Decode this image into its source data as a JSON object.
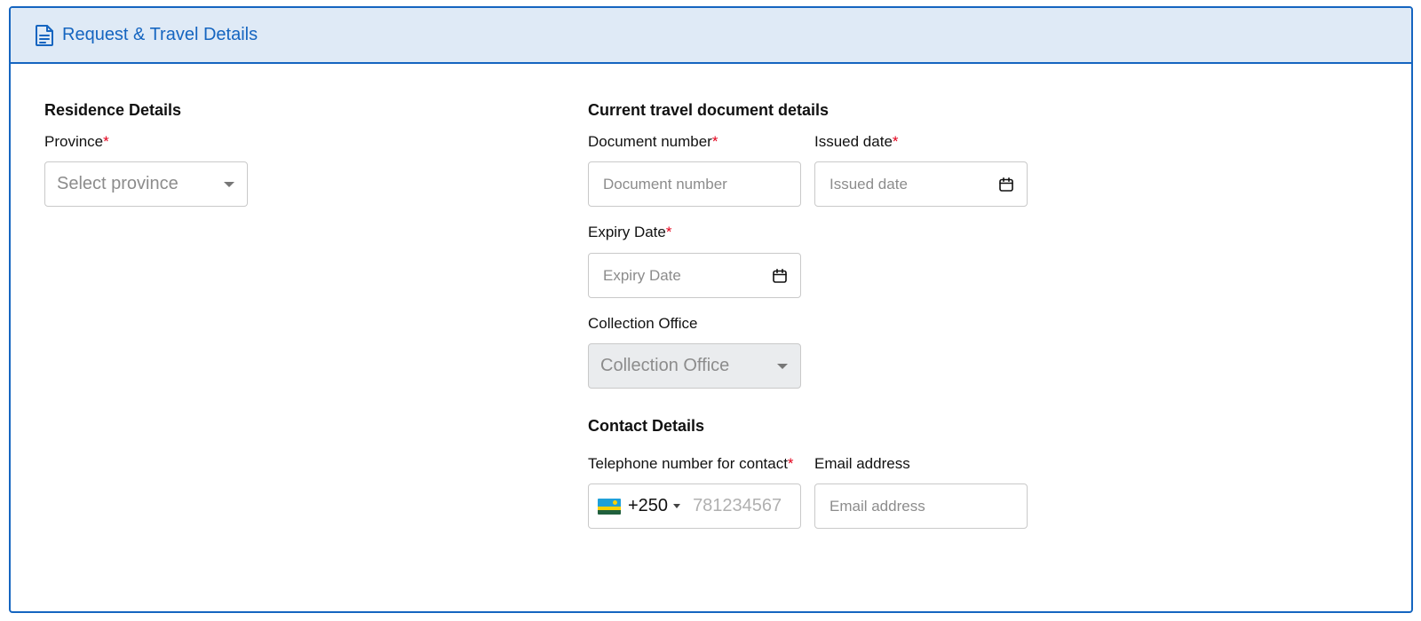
{
  "header": {
    "title": "Request & Travel Details",
    "icon": "document-icon"
  },
  "residence": {
    "title": "Residence Details",
    "province": {
      "label": "Province",
      "required": "*",
      "placeholder": "Select province"
    }
  },
  "travel_document": {
    "title": "Current travel document details",
    "document_number": {
      "label": "Document number",
      "required": "*",
      "placeholder": "Document number"
    },
    "issued_date": {
      "label": "Issued date",
      "required": "*",
      "placeholder": "Issued date",
      "icon": "calendar-icon"
    },
    "expiry_date": {
      "label": "Expiry Date",
      "required": "*",
      "placeholder": "Expiry Date",
      "icon": "calendar-icon"
    },
    "collection_office": {
      "label": "Collection Office",
      "placeholder": "Collection Office"
    }
  },
  "contact": {
    "title": "Contact Details",
    "telephone": {
      "label": "Telephone number for contact",
      "required": "*",
      "dial_code": "+250",
      "flag": "rwanda-flag-icon",
      "placeholder": "781234567"
    },
    "email": {
      "label": "Email address",
      "placeholder": "Email address"
    }
  },
  "colors": {
    "accent": "#1565c0",
    "header_bg": "#dfeaf6",
    "required": "#e3001b",
    "flag_blue": "#20a0d8",
    "flag_yellow": "#fad201",
    "flag_green": "#20603d"
  }
}
